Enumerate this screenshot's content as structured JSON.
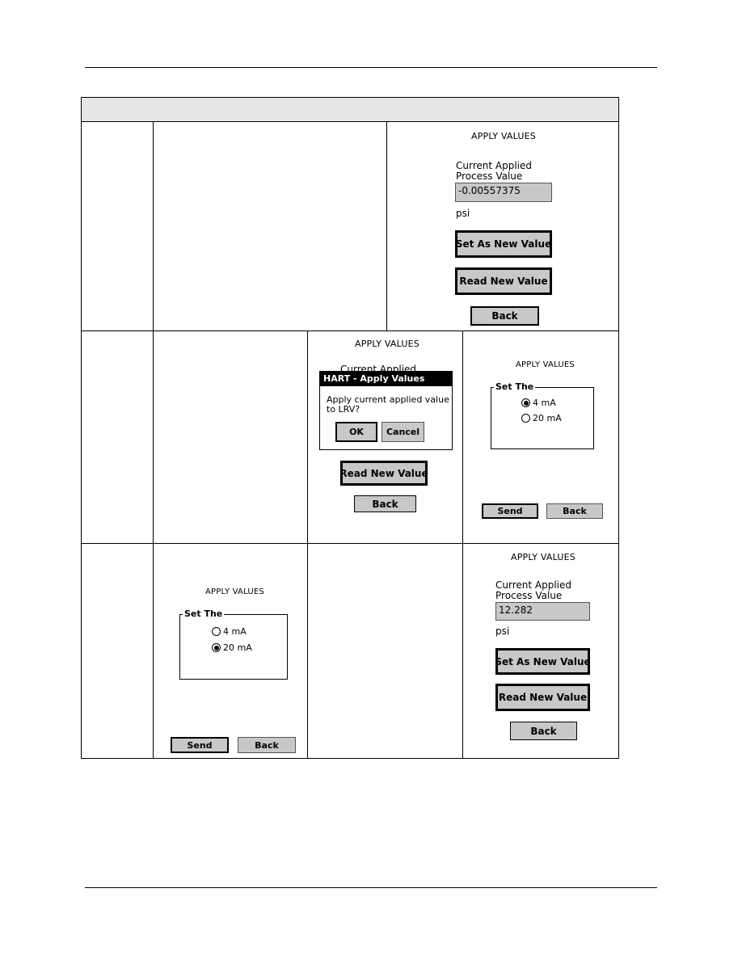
{
  "document": {
    "header_text": ""
  },
  "rows": [
    {
      "screens": [
        {
          "title": "APPLY VALUES",
          "label_line1": "Current Applied",
          "label_line2": "Process Value",
          "value": "-0.00557375",
          "unit": "psi",
          "set_button": "Set As New Value",
          "read_button": "Read New Value",
          "back_button": "Back"
        }
      ]
    },
    {
      "screens": [
        {
          "title": "APPLY VALUES",
          "partial_label": "Current Applied",
          "dialog": {
            "title": "HART - Apply Values",
            "message_line1": "Apply current applied value",
            "message_line2": "to LRV?",
            "ok": "OK",
            "cancel": "Cancel"
          },
          "read_button": "Read New Value",
          "back_button": "Back"
        },
        {
          "title": "APPLY VALUES",
          "group_label": "Set The",
          "options": [
            {
              "label": "4 mA",
              "selected": true
            },
            {
              "label": "20 mA",
              "selected": false
            }
          ],
          "send_button": "Send",
          "back_button": "Back"
        }
      ]
    },
    {
      "screens": [
        {
          "title": "APPLY VALUES",
          "group_label": "Set The",
          "options": [
            {
              "label": "4 mA",
              "selected": false
            },
            {
              "label": "20 mA",
              "selected": true
            }
          ],
          "send_button": "Send",
          "back_button": "Back"
        },
        {
          "title": "APPLY VALUES",
          "label_line1": "Current Applied",
          "label_line2": "Process Value",
          "value": "12.282",
          "unit": "psi",
          "set_button": "Set As New Value",
          "read_button": "Read New Value",
          "back_button": "Back"
        }
      ]
    }
  ]
}
